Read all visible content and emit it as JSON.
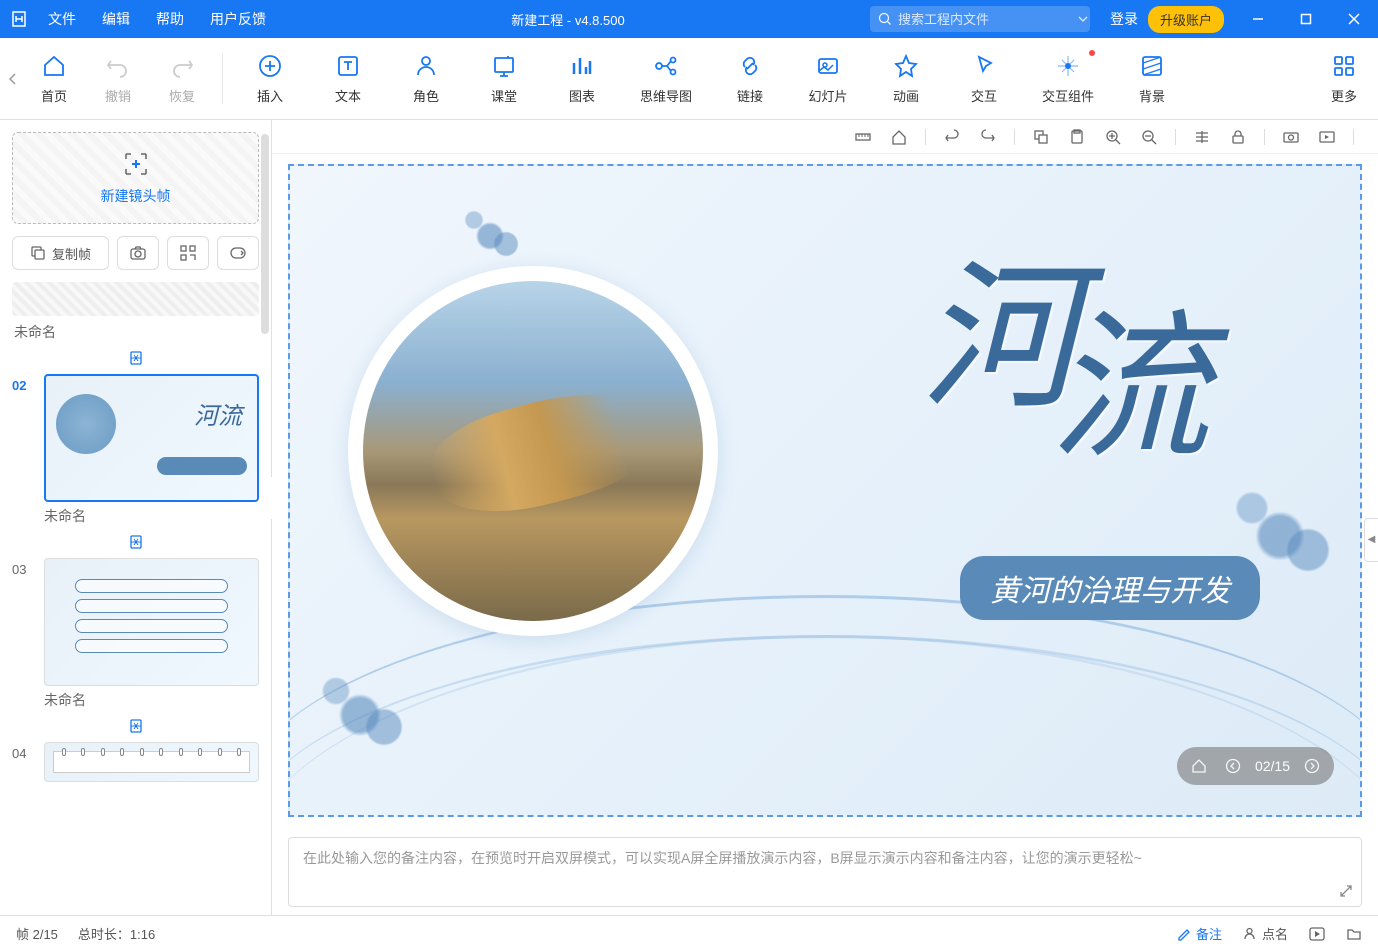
{
  "titlebar": {
    "menu": {
      "file": "文件",
      "edit": "编辑",
      "help": "帮助",
      "feedback": "用户反馈"
    },
    "title": "新建工程 - v4.8.500",
    "search_placeholder": "搜索工程内文件",
    "login": "登录",
    "upgrade": "升级账户"
  },
  "toolbar": {
    "home": "首页",
    "undo": "撤销",
    "redo": "恢复",
    "insert": "插入",
    "text": "文本",
    "role": "角色",
    "class": "课堂",
    "chart": "图表",
    "mindmap": "思维导图",
    "link": "链接",
    "slide": "幻灯片",
    "anim": "动画",
    "interact": "交互",
    "component": "交互组件",
    "bg": "背景",
    "more": "更多"
  },
  "sidebar": {
    "new_frame": "新建镜头帧",
    "copy_frame": "复制帧",
    "slides": [
      {
        "num": "",
        "label": "未命名"
      },
      {
        "num": "02",
        "label": "未命名",
        "active": true
      },
      {
        "num": "03",
        "label": "未命名"
      },
      {
        "num": "04",
        "label": ""
      }
    ]
  },
  "slide": {
    "title_c1": "河",
    "title_c2": "流",
    "subtitle": "黄河的治理与开发",
    "thumb_title": "河流",
    "nav_counter": "02/15"
  },
  "notes": {
    "placeholder": "在此处输入您的备注内容，在预览时开启双屏模式，可以实现A屏全屏播放演示内容，B屏显示演示内容和备注内容，让您的演示更轻松~"
  },
  "statusbar": {
    "frame": "帧 2/15",
    "duration": "总时长：1:16",
    "notes": "备注",
    "roll": "点名"
  }
}
